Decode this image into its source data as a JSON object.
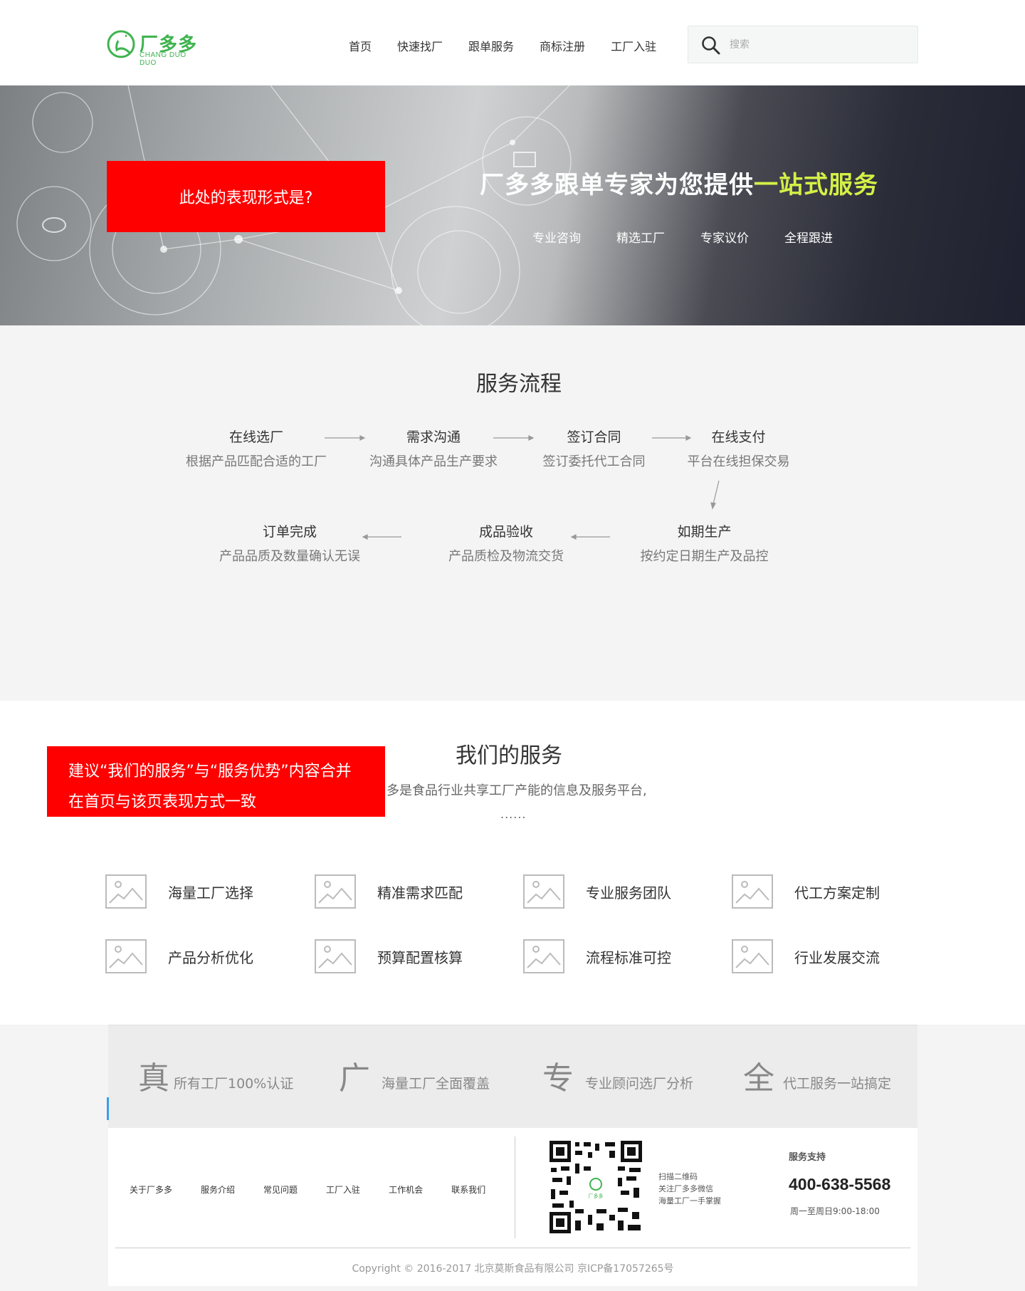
{
  "brand": {
    "name_cn": "厂多多",
    "name_en": "CHANG DUO DUO",
    "color": "#3fb34f"
  },
  "nav": {
    "items": [
      "首页",
      "快速找厂",
      "跟单服务",
      "商标注册",
      "工厂入驻"
    ]
  },
  "search": {
    "placeholder": "搜索",
    "icon": "search-icon"
  },
  "banner": {
    "title_prefix": "厂多多跟单专家为您提供",
    "title_highlight": "一站式服务",
    "highlight_color": "#d4f046",
    "features": [
      "专业咨询",
      "精选工厂",
      "专家议价",
      "全程跟进"
    ]
  },
  "notes": {
    "banner_note": "此处的表现形式是?",
    "services_note_line1": "建议“我们的服务”与“服务优势”内容合并",
    "services_note_line2": "在首页与该页表现方式一致",
    "color": "#ff0000"
  },
  "process": {
    "title": "服务流程",
    "steps": [
      {
        "title": "在线选厂",
        "desc": "根据产品匹配合适的工厂"
      },
      {
        "title": "需求沟通",
        "desc": "沟通具体产品生产要求"
      },
      {
        "title": "签订合同",
        "desc": "签订委托代工合同"
      },
      {
        "title": "在线支付",
        "desc": "平台在线担保交易"
      },
      {
        "title": "如期生产",
        "desc": "按约定日期生产及品控"
      },
      {
        "title": "成品验收",
        "desc": "产品质检及物流交货"
      },
      {
        "title": "订单完成",
        "desc": "产品品质及数量确认无误"
      }
    ]
  },
  "services": {
    "title": "我们的服务",
    "intro": "多是食品行业共享工厂产能的信息及服务平台,",
    "more": "......",
    "items": [
      "海量工厂选择",
      "精准需求匹配",
      "专业服务团队",
      "代工方案定制",
      "产品分析优化",
      "预算配置核算",
      "流程标准可控",
      "行业发展交流"
    ]
  },
  "advantages": {
    "items": [
      {
        "glyph": "真",
        "text": "所有工厂100%认证"
      },
      {
        "glyph": "广",
        "text": "海量工厂全面覆盖"
      },
      {
        "glyph": "专",
        "text": "专业顾问选厂分析"
      },
      {
        "glyph": "全",
        "text": "代工服务一站搞定"
      }
    ]
  },
  "footer": {
    "links": [
      "关于厂多多",
      "服务介绍",
      "常见问题",
      "工厂入驻",
      "工作机会",
      "联系我们"
    ],
    "qr_lines": [
      "扫描二维码",
      "关注厂多多微信",
      "海量工厂一手掌握"
    ],
    "support_label": "服务支持",
    "phone": "400-638-5568",
    "hours": "周一至周日9:00-18:00",
    "copyright": "Copyright © 2016-2017 北京莫斯食品有限公司 京ICP备17057265号"
  }
}
